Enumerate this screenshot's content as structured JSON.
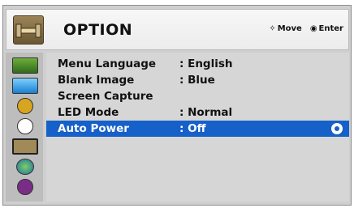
{
  "header": {
    "title": "OPTION",
    "hints": [
      {
        "icon": "dpad-icon",
        "glyph": "✧",
        "label": "Move"
      },
      {
        "icon": "enter-icon",
        "glyph": "◉",
        "label": "Enter"
      }
    ]
  },
  "sidebar": {
    "items": [
      {
        "icon": "picture-icon"
      },
      {
        "icon": "screen-icon"
      },
      {
        "icon": "audio-icon"
      },
      {
        "icon": "time-icon"
      },
      {
        "icon": "option-icon",
        "active": true
      },
      {
        "icon": "network-icon"
      },
      {
        "icon": "info-icon"
      }
    ]
  },
  "menu": {
    "items": [
      {
        "label": "Menu Language",
        "value": ": English"
      },
      {
        "label": "Blank Image",
        "value": ": Blue"
      },
      {
        "label": "Screen Capture",
        "value": ""
      },
      {
        "label": "LED Mode",
        "value": ": Normal"
      },
      {
        "label": "Auto Power",
        "value": ": Off",
        "selected": true
      }
    ]
  },
  "colors": {
    "highlight": "#1560c9",
    "panel": "#d6d6d6"
  }
}
